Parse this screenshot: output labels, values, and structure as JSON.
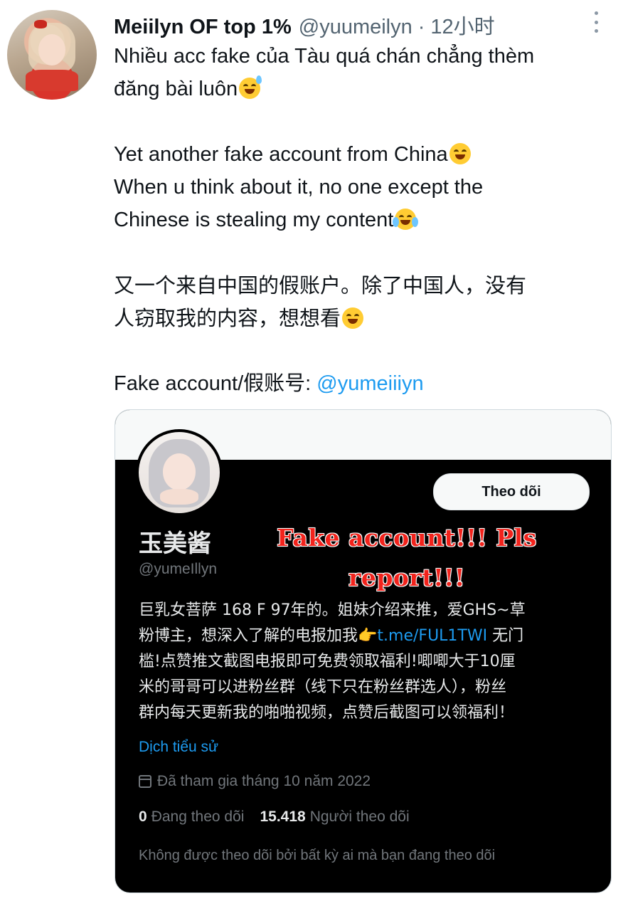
{
  "tweet": {
    "display_name": "Meiilyn OF top 1%",
    "handle": "@yuumeilyn",
    "separator": "·",
    "time": "12小时",
    "lines": {
      "vi_1": "Nhiều acc fake của Tàu quá chán chẳng thèm",
      "vi_2": "đăng bài luôn",
      "en_1": "Yet another fake account from China",
      "en_2": "When u think about it, no one except the",
      "en_3": "Chinese is stealing my content",
      "zh_1": "又一个来自中国的假账户。除了中国人，没有",
      "zh_2": "人窃取我的内容，想想看",
      "fake_label": "Fake account/假账号: ",
      "fake_mention": "@yumeiiiyn"
    }
  },
  "card": {
    "follow_button": "Theo dõi",
    "name": "玉美酱",
    "handle": "@yumeIllyn",
    "overlay_line_1": "Fake account!!! Pls",
    "overlay_line_2": "report!!!",
    "bio_1": "巨乳女菩萨 168 F 97年的。姐妹介绍来推，爱GHS~草",
    "bio_2_pre": "粉博主，想深入了解的电报加我",
    "bio_2_icon": "👉",
    "bio_2_link": "t.me/FUL1TWI",
    "bio_2_post": " 无门",
    "bio_3": "槛!点赞推文截图电报即可免费领取福利!唧唧大于10厘",
    "bio_4": "米的哥哥可以进粉丝群（线下只在粉丝群选人），粉丝",
    "bio_5": "群内每天更新我的啪啪视频，点赞后截图可以领福利！",
    "translate": "Dịch tiểu sử",
    "joined": "Đã tham gia tháng 10 năm 2022",
    "following_count": "0",
    "following_label": "Đang theo dõi",
    "followers_count": "15.418",
    "followers_label": "Người theo dõi",
    "not_followed": "Không được theo dõi bởi bất kỳ ai mà bạn đang theo dõi"
  },
  "icons": {
    "more": "more-vertical-icon",
    "calendar": "calendar-icon",
    "emoji_sweat": "grinning-sweat-emoji",
    "emoji_grin": "grinning-emoji",
    "emoji_tears": "tears-of-joy-emoji"
  },
  "colors": {
    "link": "#1d9bf0",
    "secondary_text": "#536471",
    "card_background": "#000000",
    "overlay_red": "#f2231c"
  }
}
